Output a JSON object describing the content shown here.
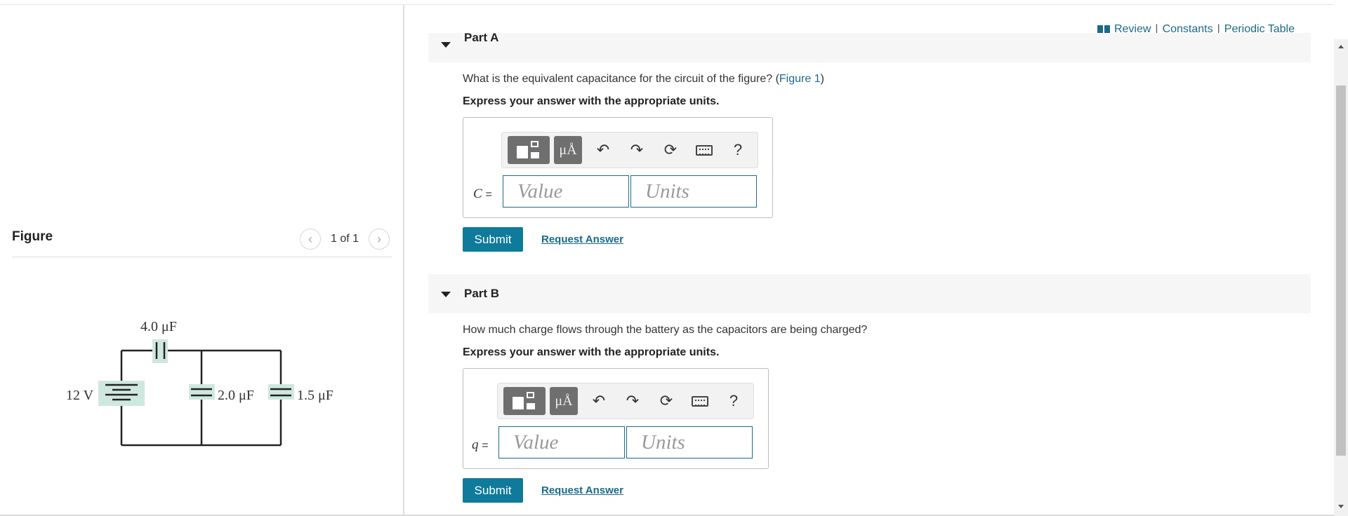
{
  "figure_panel": {
    "title": "Figure",
    "counter": "1 of 1",
    "prev_icon": "chevron-left-icon",
    "next_icon": "chevron-right-icon",
    "circuit": {
      "battery_label": "12 V",
      "c1_label": "4.0 μF",
      "c2_label": "2.0 μF",
      "c3_label": "1.5 μF"
    }
  },
  "top_links": {
    "icon": "book-icon",
    "review": "Review",
    "constants": "Constants",
    "periodic_table": "Periodic Table",
    "separator": "|"
  },
  "parts": [
    {
      "label": "Part A",
      "question_text": "What is the equivalent capacitance for the circuit of the figure? (",
      "figure_link": "Figure 1",
      "question_close": ")",
      "instruction": "Express your answer with the appropriate units.",
      "variable": "C",
      "equals": "=",
      "value_placeholder": "Value",
      "units_placeholder": "Units",
      "submit": "Submit",
      "request": "Request Answer"
    },
    {
      "label": "Part B",
      "question_text": "How much charge flows through the battery as the capacitors are being charged?",
      "instruction": "Express your answer with the appropriate units.",
      "variable": "q",
      "equals": "=",
      "value_placeholder": "Value",
      "units_placeholder": "Units",
      "submit": "Submit",
      "request": "Request Answer"
    }
  ],
  "toolbar": {
    "units_button": "μÅ",
    "help": "?",
    "icons": [
      "templates-icon",
      "units-icon",
      "undo-icon",
      "redo-icon",
      "reset-icon",
      "keyboard-icon",
      "help-icon"
    ]
  },
  "colors": {
    "link": "#1a6a8a",
    "submit_bg": "#0f7a9a",
    "part_header_bg": "#f6f6f6"
  }
}
